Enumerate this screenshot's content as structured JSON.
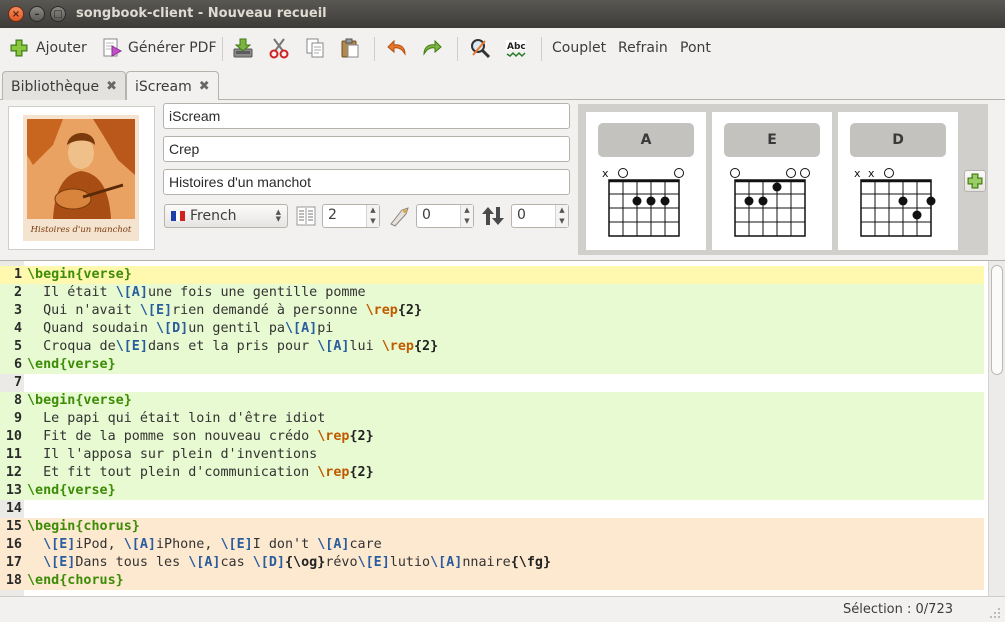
{
  "window": {
    "title": "songbook-client - Nouveau recueil"
  },
  "toolbar": {
    "add_label": "Ajouter",
    "pdf_label": "Générer PDF",
    "verse_label": "Couplet",
    "chorus_label": "Refrain",
    "bridge_label": "Pont",
    "icons": [
      "plus-icon",
      "pdf-icon",
      "save-icon",
      "cut-icon",
      "copy-icon",
      "paste-icon",
      "undo-icon",
      "redo-icon",
      "find-replace-icon",
      "spellcheck-icon"
    ]
  },
  "tabs": [
    {
      "label": "Bibliothèque",
      "active": false
    },
    {
      "label": "iScream",
      "active": true
    }
  ],
  "song": {
    "title": "iScream",
    "artist": "Crep",
    "album": "Histoires d'un manchot",
    "cover_text": "Histoires d'un manchot",
    "language": "French",
    "columns": "2",
    "capo": "0",
    "transpose": "0"
  },
  "chords": [
    {
      "name": "A"
    },
    {
      "name": "E"
    },
    {
      "name": "D"
    }
  ],
  "editor": {
    "lines": [
      {
        "n": "1",
        "env": "verse",
        "current": true
      },
      {
        "n": "2",
        "env": "verse"
      },
      {
        "n": "3",
        "env": "verse"
      },
      {
        "n": "4",
        "env": "verse"
      },
      {
        "n": "5",
        "env": "verse"
      },
      {
        "n": "6",
        "env": "verse"
      },
      {
        "n": "7",
        "env": "none"
      },
      {
        "n": "8",
        "env": "verse"
      },
      {
        "n": "9",
        "env": "verse"
      },
      {
        "n": "10",
        "env": "verse"
      },
      {
        "n": "11",
        "env": "verse"
      },
      {
        "n": "12",
        "env": "verse"
      },
      {
        "n": "13",
        "env": "verse"
      },
      {
        "n": "14",
        "env": "none"
      },
      {
        "n": "15",
        "env": "chorus"
      },
      {
        "n": "16",
        "env": "chorus"
      },
      {
        "n": "17",
        "env": "chorus"
      },
      {
        "n": "18",
        "env": "chorus"
      }
    ],
    "text": {
      "l1": [
        "\\begin",
        "{verse}"
      ],
      "l2": [
        "  Il était ",
        "\\[A]",
        "une fois une gentille pomme"
      ],
      "l3": [
        "  Qui n'avait ",
        "\\[E]",
        "rien demandé à personne ",
        "\\rep",
        "{2}"
      ],
      "l4": [
        "  Quand soudain ",
        "\\[D]",
        "un gentil pa",
        "\\[A]",
        "pi"
      ],
      "l5": [
        "  Croqua de",
        "\\[E]",
        "dans et la pris pour ",
        "\\[A]",
        "lui ",
        "\\rep",
        "{2}"
      ],
      "l6": [
        "\\end",
        "{verse}"
      ],
      "l8": [
        "\\begin",
        "{verse}"
      ],
      "l9": [
        "  Le papi qui était loin d'être idiot"
      ],
      "l10": [
        "  Fit de la pomme son nouveau crédo ",
        "\\rep",
        "{2}"
      ],
      "l11": [
        "  Il l'apposa sur plein d'inventions"
      ],
      "l12": [
        "  Et fit tout plein d'communication ",
        "\\rep",
        "{2}"
      ],
      "l13": [
        "\\end",
        "{verse}"
      ],
      "l15": [
        "\\begin",
        "{chorus}"
      ],
      "l16": [
        "  ",
        "\\[E]",
        "iPod, ",
        "\\[A]",
        "iPhone, ",
        "\\[E]",
        "I don't ",
        "\\[A]",
        "care"
      ],
      "l17": [
        "  ",
        "\\[E]",
        "Dans tous les ",
        "\\[A]",
        "cas ",
        "\\[D]",
        "{\\og}",
        "révo",
        "\\[E]",
        "lutio",
        "\\[A]",
        "nnaire",
        "{\\fg}"
      ],
      "l18": [
        "\\end",
        "{chorus}"
      ]
    }
  },
  "status": {
    "selection": "Sélection : 0/723"
  },
  "colors": {
    "verse_bg": "#e8fad1",
    "chorus_bg": "#fde9d0",
    "current_line": "#fff9b0",
    "keyword": "#3d8c07",
    "chord": "#2a5d9f",
    "repeat": "#c05a00"
  }
}
